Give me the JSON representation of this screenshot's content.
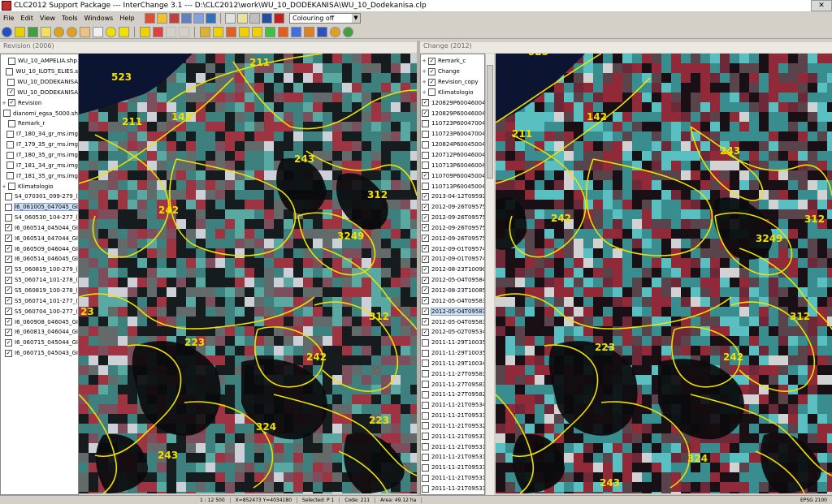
{
  "window": {
    "title": "CLC2012 Support Package --- InterChange 3.1 --- D:\\CLC2012\\work\\WU_10_DODEKANISA\\WU_10_Dodekanisa.clp"
  },
  "menu": [
    "File",
    "Edit",
    "View",
    "Tools",
    "Windows",
    "Help"
  ],
  "toolbar": {
    "colouring_select": "Colouring off"
  },
  "left_panel": {
    "title": "Revision (2006)",
    "layers": [
      {
        "exp": "",
        "checked": false,
        "label": "WU_10_AMPELIA.shp"
      },
      {
        "exp": "",
        "checked": false,
        "label": "WU_10_ILOTS_ELIES.s"
      },
      {
        "exp": "",
        "checked": false,
        "label": "WU_10_DODEKANISA"
      },
      {
        "exp": "",
        "checked": true,
        "label": "WU_10_DODEKANISA"
      },
      {
        "exp": "+",
        "checked": true,
        "label": "Revision"
      },
      {
        "exp": "",
        "checked": false,
        "label": "dianomi_egsa_5000.sh"
      },
      {
        "exp": "",
        "checked": false,
        "label": "Remark_r"
      },
      {
        "exp": "",
        "checked": false,
        "label": "I7_180_34_gr_ms.img"
      },
      {
        "exp": "",
        "checked": false,
        "label": "I7_179_35_gr_ms.img"
      },
      {
        "exp": "",
        "checked": false,
        "label": "I7_180_35_gr_ms.img"
      },
      {
        "exp": "",
        "checked": false,
        "label": "I7_181_34_gr_ms.img"
      },
      {
        "exp": "",
        "checked": false,
        "label": "I7_181_35_gr_ms.img"
      },
      {
        "exp": "+",
        "checked": false,
        "label": "Klimatologio"
      },
      {
        "exp": "",
        "checked": false,
        "label": "S4_070301_099-279_("
      },
      {
        "exp": "",
        "checked": false,
        "label": "I6_061005_047045_GI",
        "selected": true
      },
      {
        "exp": "",
        "checked": false,
        "label": "S4_060530_104-277_("
      },
      {
        "exp": "",
        "checked": true,
        "label": "I6_060514_045044_GI"
      },
      {
        "exp": "",
        "checked": true,
        "label": "I6_060514_047044_GI"
      },
      {
        "exp": "",
        "checked": true,
        "label": "I6_060509_046044_GI"
      },
      {
        "exp": "",
        "checked": true,
        "label": "I6_060514_046045_GI"
      },
      {
        "exp": "",
        "checked": true,
        "label": "S5_060819_100-279_("
      },
      {
        "exp": "",
        "checked": true,
        "label": "S5_060714_101-278_("
      },
      {
        "exp": "",
        "checked": true,
        "label": "S5_060819_100-278_("
      },
      {
        "exp": "",
        "checked": true,
        "label": "S5_060714_101-277_("
      },
      {
        "exp": "",
        "checked": true,
        "label": "S5_060704_100-277_("
      },
      {
        "exp": "",
        "checked": true,
        "label": "I6_060908_046045_GI"
      },
      {
        "exp": "",
        "checked": true,
        "label": "I6_060813_046044_GI"
      },
      {
        "exp": "",
        "checked": true,
        "label": "I6_060715_045044_GI"
      },
      {
        "exp": "",
        "checked": true,
        "label": "I6_060715_045043_GI"
      }
    ]
  },
  "right_panel": {
    "title": "Change (2012)",
    "layers": [
      {
        "exp": "+",
        "checked": true,
        "label": "Remark_c"
      },
      {
        "exp": "+",
        "checked": true,
        "label": "Change"
      },
      {
        "exp": "+",
        "checked": true,
        "label": "Revision_copy"
      },
      {
        "exp": "+",
        "checked": false,
        "label": "Klimatologio"
      },
      {
        "exp": "",
        "checked": true,
        "label": "120829P60046004"
      },
      {
        "exp": "",
        "checked": true,
        "label": "120829P60046004"
      },
      {
        "exp": "",
        "checked": false,
        "label": "110723P60047004"
      },
      {
        "exp": "",
        "checked": false,
        "label": "110723P60047004"
      },
      {
        "exp": "",
        "checked": false,
        "label": "120824P60045004"
      },
      {
        "exp": "",
        "checked": false,
        "label": "120712P60046004"
      },
      {
        "exp": "",
        "checked": false,
        "label": "110713P60046004"
      },
      {
        "exp": "",
        "checked": true,
        "label": "110709P60045004"
      },
      {
        "exp": "",
        "checked": false,
        "label": "110713P60045004"
      },
      {
        "exp": "",
        "checked": true,
        "label": "2013-04-12T09592"
      },
      {
        "exp": "",
        "checked": true,
        "label": "2012-09-26T09575"
      },
      {
        "exp": "",
        "checked": true,
        "label": "2012-09-26T09575"
      },
      {
        "exp": "",
        "checked": true,
        "label": "2012-09-26T09575"
      },
      {
        "exp": "",
        "checked": true,
        "label": "2012-09-26T09575"
      },
      {
        "exp": "",
        "checked": true,
        "label": "2012-09-01T09574"
      },
      {
        "exp": "",
        "checked": true,
        "label": "2012-09-01T09574"
      },
      {
        "exp": "",
        "checked": true,
        "label": "2012-08-23T10090"
      },
      {
        "exp": "",
        "checked": true,
        "label": "2012-05-04T09584"
      },
      {
        "exp": "",
        "checked": true,
        "label": "2012-08-23T10085"
      },
      {
        "exp": "",
        "checked": true,
        "label": "2012-05-04T09583"
      },
      {
        "exp": "",
        "checked": true,
        "label": "2012-05-04T09583",
        "selected": true
      },
      {
        "exp": "",
        "checked": true,
        "label": "2012-05-04T09583"
      },
      {
        "exp": "",
        "checked": true,
        "label": "2012-05-02T09534"
      },
      {
        "exp": "",
        "checked": false,
        "label": "2011-11-29T10035"
      },
      {
        "exp": "",
        "checked": false,
        "label": "2011-11-29T10035"
      },
      {
        "exp": "",
        "checked": false,
        "label": "2011-11-29T10034"
      },
      {
        "exp": "",
        "checked": false,
        "label": "2011-11-27T09583"
      },
      {
        "exp": "",
        "checked": false,
        "label": "2011-11-27T09583"
      },
      {
        "exp": "",
        "checked": false,
        "label": "2011-11-27T09582"
      },
      {
        "exp": "",
        "checked": false,
        "label": "2011-11-21T09534"
      },
      {
        "exp": "",
        "checked": false,
        "label": "2011-11-21T09533"
      },
      {
        "exp": "",
        "checked": false,
        "label": "2011-11-21T09532"
      },
      {
        "exp": "",
        "checked": false,
        "label": "2011-11-21T09531"
      },
      {
        "exp": "",
        "checked": false,
        "label": "2011-11-21T09531"
      },
      {
        "exp": "",
        "checked": false,
        "label": "2011-11-21T09531"
      },
      {
        "exp": "",
        "checked": false,
        "label": "2011-11-21T09531"
      },
      {
        "exp": "",
        "checked": false,
        "label": "2011-11-21T09531"
      },
      {
        "exp": "",
        "checked": false,
        "label": "2011-11-21T09531"
      }
    ]
  },
  "map_left": {
    "labels": [
      "523",
      "211",
      "211",
      "142",
      "243",
      "242",
      "312",
      "3249",
      "23",
      "312",
      "223",
      "242",
      "324",
      "223",
      "243"
    ]
  },
  "map_right": {
    "labels": [
      "523",
      "211",
      "142",
      "243",
      "242",
      "312",
      "3249",
      "312",
      "223",
      "242",
      "324",
      "243"
    ]
  },
  "status": {
    "scale": "1 : 12 500",
    "coords": "X=852473  Y=4034180",
    "selected": "Selected: P 1",
    "code": "Code: 211",
    "area": "Area: 49.12 ha",
    "epsg": "EPSG 2100"
  },
  "colors": {
    "polygon_outline": "#f0e000",
    "label": "#f0e000",
    "selection": "#cfe0f6"
  }
}
